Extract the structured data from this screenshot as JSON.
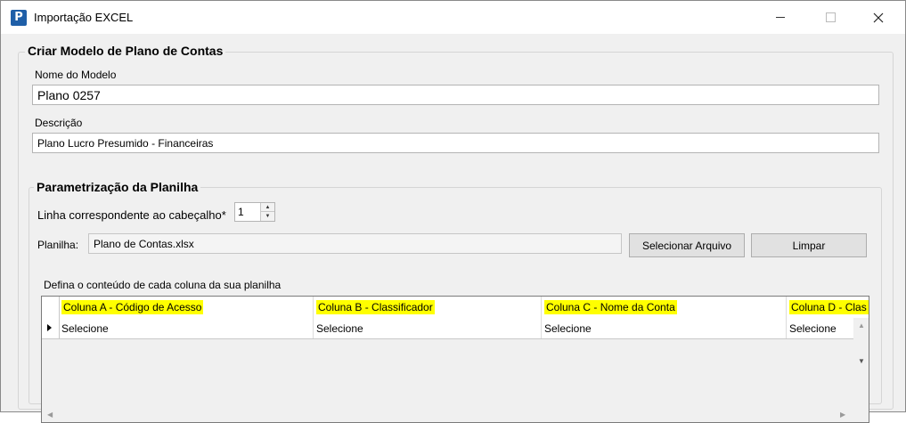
{
  "window": {
    "title": "Importação EXCEL",
    "app_icon_letter": "P"
  },
  "modelo": {
    "group_title": "Criar Modelo de Plano de Contas",
    "nome_label": "Nome do Modelo",
    "nome_value": "Plano 0257",
    "descricao_label": "Descrição",
    "descricao_value": "Plano Lucro Presumido - Financeiras"
  },
  "parametrizacao": {
    "group_title": "Parametrização da Planilha",
    "header_line_label": "Linha correspondente ao cabeçalho*",
    "header_line_value": "1",
    "planilha_label": "Planilha:",
    "planilha_value": "Plano de Contas.xlsx",
    "select_file_button": "Selecionar Arquivo",
    "clear_button": "Limpar",
    "columns_hint": "Defina o conteúdo de cada coluna da sua planilha"
  },
  "grid": {
    "columns": [
      "Coluna A - Código de Acesso",
      "Coluna B - Classificador",
      "Coluna C - Nome da Conta",
      "Coluna D - Clas"
    ],
    "rows": [
      [
        "Selecione",
        "Selecione",
        "Selecione",
        "Selecione"
      ]
    ],
    "highlight_color": "#ffff00"
  },
  "icons": {
    "app": "app-logo-icon",
    "minimize": "minimize-icon",
    "maximize": "maximize-icon",
    "close": "close-icon",
    "current_row": "row-pointer-icon"
  }
}
